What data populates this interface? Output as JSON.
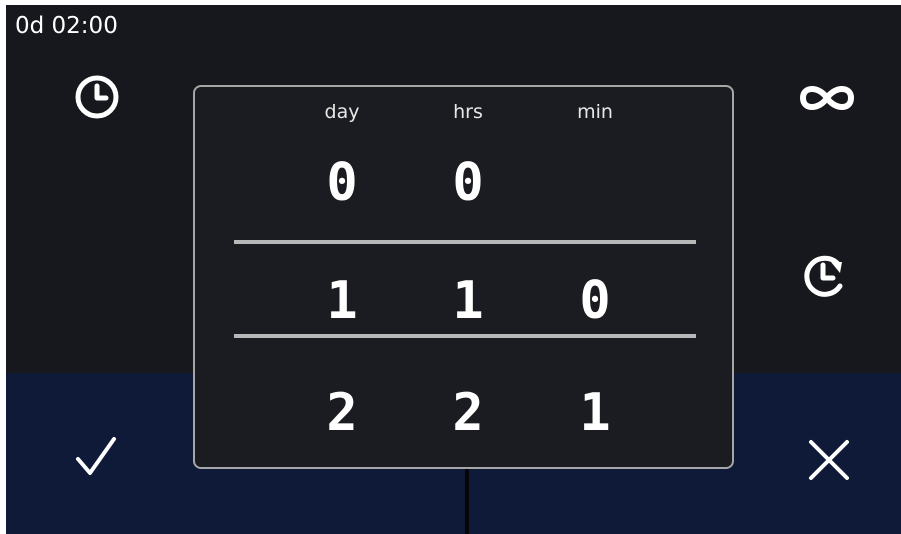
{
  "status": {
    "time_text": "0d 02:00"
  },
  "picker": {
    "labels": [
      "day",
      "hrs",
      "min"
    ],
    "rows": [
      [
        "0",
        "0",
        ""
      ],
      [
        "1",
        "1",
        "0"
      ],
      [
        "2",
        "2",
        "1"
      ]
    ]
  },
  "icons": {
    "clock": "clock-icon",
    "infinity": "infinity-icon",
    "restart": "restart-clock-icon",
    "confirm": "check-icon",
    "cancel": "close-icon"
  },
  "colors": {
    "background": "#16181d",
    "bottom_bar": "#0f1a39",
    "dialog_border": "#a6a6a6",
    "text": "#ffffff"
  }
}
